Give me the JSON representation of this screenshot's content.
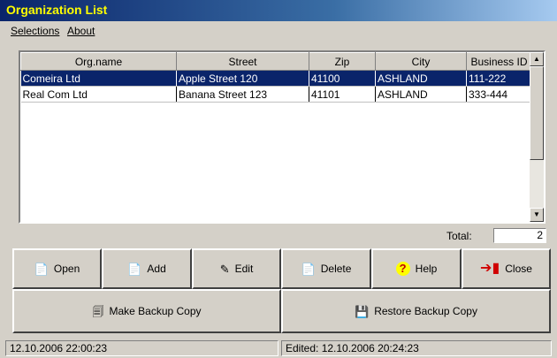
{
  "window": {
    "title": "Organization List"
  },
  "menu": {
    "items": [
      "Selections",
      "About"
    ]
  },
  "table": {
    "columns": [
      "Org.name",
      "Street",
      "Zip",
      "City",
      "Business ID"
    ],
    "rows": [
      [
        "Comeira Ltd",
        "Apple Street 120",
        "41100",
        "ASHLAND",
        "111-222"
      ],
      [
        "Real Com Ltd",
        "Banana Street 123",
        "41101",
        "ASHLAND",
        "333-444"
      ]
    ],
    "selected_row": 0
  },
  "total": {
    "label": "Total:",
    "value": "2"
  },
  "buttons": {
    "open": "Open",
    "add": "Add",
    "edit": "Edit",
    "delete": "Delete",
    "help": "Help",
    "close": "Close",
    "backup": "Make Backup Copy",
    "restore": "Restore Backup Copy"
  },
  "icons": {
    "open": "document-open-icon",
    "add": "document-add-icon",
    "edit": "document-edit-icon",
    "delete": "document-delete-icon",
    "help": "help-question-icon",
    "close": "exit-door-icon",
    "backup": "backup-copy-icon",
    "restore": "restore-floppy-icon"
  },
  "status": {
    "left": "12.10.2006    22:00:23",
    "right": "Edited: 12.10.2006    20:24:23"
  },
  "colors": {
    "title_text": "#ffff00",
    "title_bg": "#0a246a",
    "selection_bg": "#0a246a",
    "face": "#d4d0c8"
  }
}
